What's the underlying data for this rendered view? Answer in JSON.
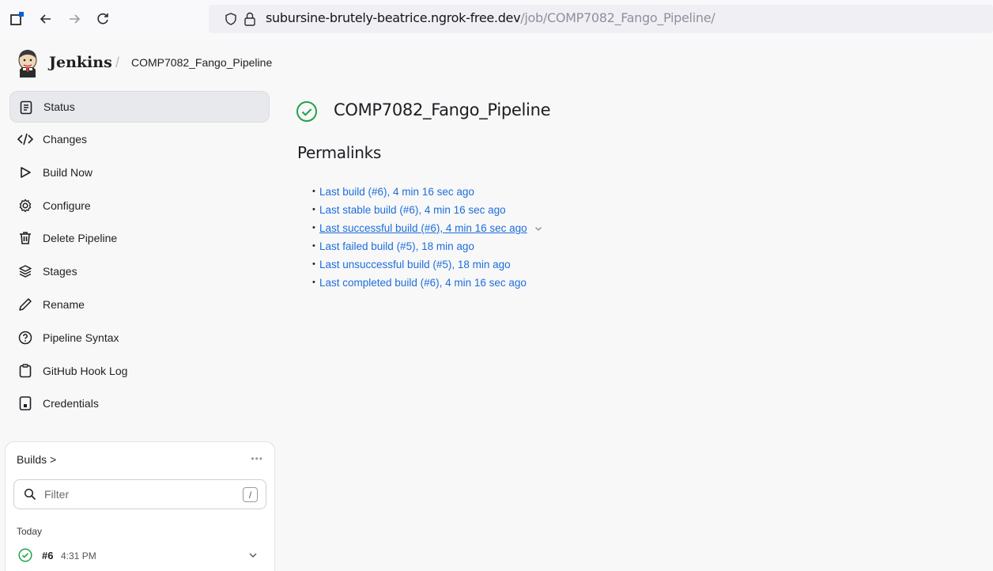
{
  "browser": {
    "url_host": "subursine-brutely-beatrice.ngrok-free.dev",
    "url_path": "/job/COMP7082_Fango_Pipeline/"
  },
  "header": {
    "brand": "Jenkins",
    "separator": "/",
    "breadcrumb": "COMP7082_Fango_Pipeline"
  },
  "sidebar": {
    "items": [
      {
        "label": "Status",
        "icon": "status-icon"
      },
      {
        "label": "Changes",
        "icon": "code-icon"
      },
      {
        "label": "Build Now",
        "icon": "play-icon"
      },
      {
        "label": "Configure",
        "icon": "gear-icon"
      },
      {
        "label": "Delete Pipeline",
        "icon": "trash-icon"
      },
      {
        "label": "Stages",
        "icon": "layers-icon"
      },
      {
        "label": "Rename",
        "icon": "pencil-icon"
      },
      {
        "label": "Pipeline Syntax",
        "icon": "help-icon"
      },
      {
        "label": "GitHub Hook Log",
        "icon": "clipboard-icon"
      },
      {
        "label": "Credentials",
        "icon": "phone-icon"
      }
    ]
  },
  "builds": {
    "title": "Builds >",
    "more": "•••",
    "filter_placeholder": "Filter",
    "filter_key": "/",
    "group": "Today",
    "rows": [
      {
        "number": "#6",
        "time": "4:31 PM",
        "status": "success"
      }
    ]
  },
  "main": {
    "job_title": "COMP7082_Fango_Pipeline",
    "permalinks_title": "Permalinks",
    "permalinks": [
      "Last build (#6), 4 min 16 sec ago",
      "Last stable build (#6), 4 min 16 sec ago",
      "Last successful build (#6), 4 min 16 sec ago",
      "Last failed build (#5), 18 min ago",
      "Last unsuccessful build (#5), 18 min ago",
      "Last completed build (#6), 4 min 16 sec ago"
    ]
  },
  "colors": {
    "link": "#1d6ed8",
    "success": "#1ea446"
  }
}
